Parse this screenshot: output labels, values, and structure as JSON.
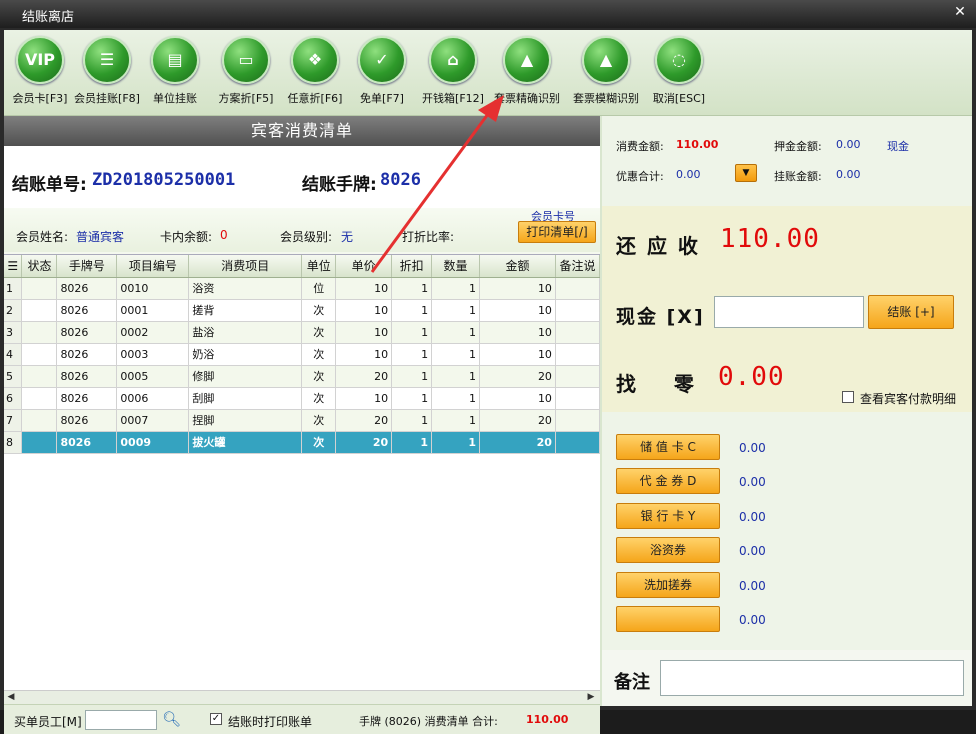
{
  "window": {
    "title": "结账离店"
  },
  "toolbar": [
    {
      "label": "会员卡[F3]",
      "glyph": "VIP"
    },
    {
      "label": "会员挂账[F8]",
      "glyph": "☰"
    },
    {
      "label": "单位挂账",
      "glyph": "▤"
    },
    {
      "label": "方案折[F5]",
      "glyph": "▭"
    },
    {
      "label": "任意折[F6]",
      "glyph": "❖"
    },
    {
      "label": "免单[F7]",
      "glyph": "✓"
    },
    {
      "label": "开钱箱[F12]",
      "glyph": "⌂"
    },
    {
      "label": "套票精确识别",
      "glyph": "▲"
    },
    {
      "label": "套票模糊识别",
      "glyph": "▲"
    },
    {
      "label": "取消[ESC]",
      "glyph": "◌"
    }
  ],
  "list": {
    "heading": "宾客消费清单",
    "bill_no_label": "结账单号:",
    "bill_no": "ZD201805250001",
    "plate_label": "结账手牌:",
    "plate": "8026"
  },
  "member": {
    "name_label": "会员姓名:",
    "name": "普通宾客",
    "balance_label": "卡内余额:",
    "balance": "0",
    "level_label": "会员级别:",
    "level": "无",
    "discount_label": "打折比率:",
    "card_no_label": "会员卡号",
    "print_btn": "打印清单[/]"
  },
  "table": {
    "columns": [
      "状态",
      "手牌号",
      "项目编号",
      "消费项目",
      "单位",
      "单价",
      "折扣",
      "数量",
      "金额",
      "备注说"
    ],
    "rows": [
      {
        "n": "1",
        "plate": "8026",
        "code": "0010",
        "item": "浴资",
        "unit": "位",
        "price": "10",
        "disc": "1",
        "qty": "1",
        "amt": "10"
      },
      {
        "n": "2",
        "plate": "8026",
        "code": "0001",
        "item": "搓背",
        "unit": "次",
        "price": "10",
        "disc": "1",
        "qty": "1",
        "amt": "10"
      },
      {
        "n": "3",
        "plate": "8026",
        "code": "0002",
        "item": "盐浴",
        "unit": "次",
        "price": "10",
        "disc": "1",
        "qty": "1",
        "amt": "10"
      },
      {
        "n": "4",
        "plate": "8026",
        "code": "0003",
        "item": "奶浴",
        "unit": "次",
        "price": "10",
        "disc": "1",
        "qty": "1",
        "amt": "10"
      },
      {
        "n": "5",
        "plate": "8026",
        "code": "0005",
        "item": "修脚",
        "unit": "次",
        "price": "20",
        "disc": "1",
        "qty": "1",
        "amt": "20"
      },
      {
        "n": "6",
        "plate": "8026",
        "code": "0006",
        "item": "刮脚",
        "unit": "次",
        "price": "10",
        "disc": "1",
        "qty": "1",
        "amt": "10"
      },
      {
        "n": "7",
        "plate": "8026",
        "code": "0007",
        "item": "捏脚",
        "unit": "次",
        "price": "20",
        "disc": "1",
        "qty": "1",
        "amt": "20"
      },
      {
        "n": "8",
        "plate": "8026",
        "code": "0009",
        "item": "拔火罐",
        "unit": "次",
        "price": "20",
        "disc": "1",
        "qty": "1",
        "amt": "20"
      }
    ]
  },
  "bottom": {
    "buyer_label": "买单员工[M]",
    "print_on_checkout": "结账时打印账单",
    "summary_prefix": "手牌 (8026) 消费清单 合计:",
    "summary_total": "110.00"
  },
  "summary": {
    "consume_label": "消费金额:",
    "consume": "110.00",
    "deposit_label": "押金金额:",
    "deposit": "0.00",
    "deposit_type": "现金",
    "discount_label": "优惠合计:",
    "discount": "0.00",
    "credit_label": "挂账金额:",
    "credit": "0.00"
  },
  "pay": {
    "due_label": "还 应 收",
    "due": "110.00",
    "cash_label": "现金 [X]",
    "cash_value": "",
    "checkout_btn": "结账 [+]",
    "change_label": "找    零",
    "change": "0.00",
    "detail_check": "查看宾客付款明细"
  },
  "methods": [
    {
      "label": "储 值 卡 C",
      "amount": "0.00"
    },
    {
      "label": "代 金 券 D",
      "amount": "0.00"
    },
    {
      "label": "银 行 卡 Y",
      "amount": "0.00"
    },
    {
      "label": "浴资券",
      "amount": "0.00"
    },
    {
      "label": "洗加搓券",
      "amount": "0.00"
    },
    {
      "label": "",
      "amount": "0.00"
    }
  ],
  "remark": {
    "label": "备注",
    "value": ""
  },
  "colors": {
    "accent_red": "#e10a0a",
    "value_blue": "#1c2fa8",
    "selected_row": "#35a3c0",
    "button_orange": "#f5a51a"
  }
}
